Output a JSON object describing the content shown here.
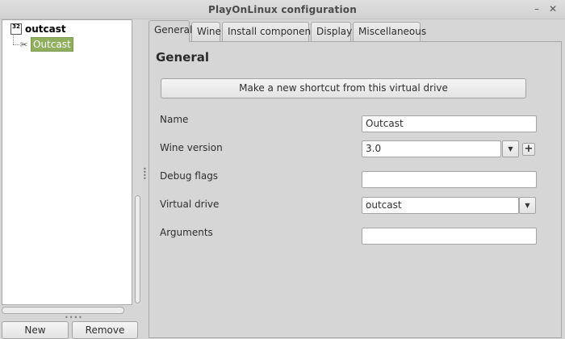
{
  "window": {
    "title": "PlayOnLinux configuration"
  },
  "titlebar": {
    "minimize_icon": "minimize-icon",
    "close_icon": "close-icon",
    "minimize_glyph": "–",
    "close_glyph": "✕"
  },
  "tree": {
    "root": {
      "label": "outcast",
      "icon": "32-bit-drive-icon",
      "icon_text": "32"
    },
    "items": [
      {
        "label": "Outcast",
        "icon": "game-shortcut-icon"
      }
    ]
  },
  "left_buttons": {
    "new_label": "New",
    "remove_label": "Remove"
  },
  "tabs": [
    {
      "label": "General",
      "active": true
    },
    {
      "label": "Wine",
      "active": false
    },
    {
      "label": "Install components",
      "active": false
    },
    {
      "label": "Display",
      "active": false
    },
    {
      "label": "Miscellaneous",
      "active": false
    }
  ],
  "general": {
    "heading": "General",
    "shortcut_button_label": "Make a new shortcut from this virtual drive",
    "fields": {
      "name": {
        "label": "Name",
        "value": "Outcast"
      },
      "wine_version": {
        "label": "Wine version",
        "value": "3.0"
      },
      "debug_flags": {
        "label": "Debug flags",
        "value": ""
      },
      "virtual_drive": {
        "label": "Virtual drive",
        "value": "outcast"
      },
      "arguments": {
        "label": "Arguments",
        "value": ""
      }
    }
  },
  "colors": {
    "selection": "#8fae5e",
    "window_bg": "#d6d6d6"
  }
}
